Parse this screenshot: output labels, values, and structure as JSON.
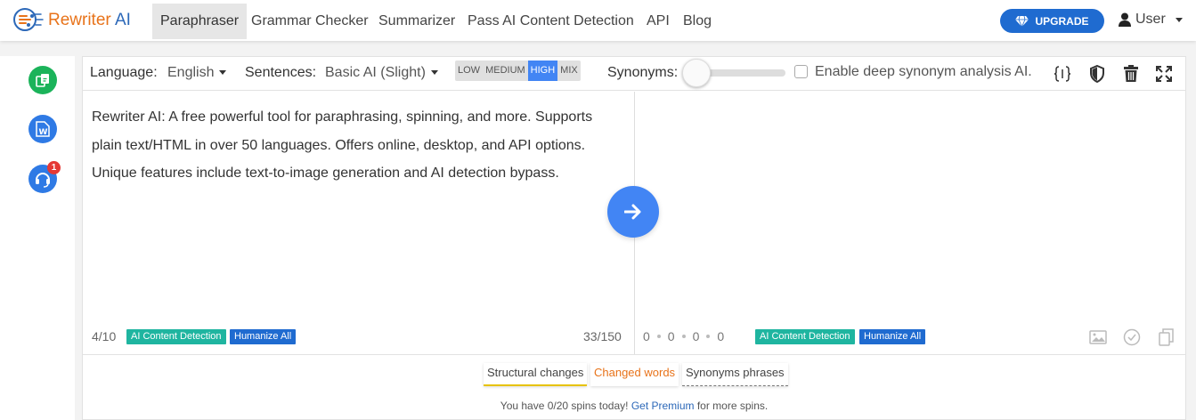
{
  "brand": {
    "name_main": "Rewriter",
    "name_ai": "AI"
  },
  "nav": {
    "items": [
      {
        "label": "Paraphraser",
        "active": true
      },
      {
        "label": "Grammar Checker",
        "active": false
      },
      {
        "label": "Summarizer",
        "active": false
      },
      {
        "label": "Pass AI Content Detection",
        "active": false
      },
      {
        "label": "API",
        "active": false
      },
      {
        "label": "Blog",
        "active": false
      }
    ],
    "upgrade_label": "UPGRADE",
    "user_label": "User"
  },
  "sidebar": {
    "items": [
      {
        "icon": "copy-document-icon",
        "color": "#1bb35a"
      },
      {
        "icon": "word-document-icon",
        "color": "#2f7ae5"
      },
      {
        "icon": "support-headset-icon",
        "color": "#2f7ae5",
        "badge": "1"
      }
    ]
  },
  "toolbar": {
    "language_label": "Language:",
    "language_value": "English",
    "sentences_label": "Sentences:",
    "sentences_value": "Basic AI (Slight)",
    "levels": [
      "LOW",
      "MEDIUM",
      "HIGH",
      "MIX"
    ],
    "active_level": "HIGH",
    "synonyms_label": "Synonyms:",
    "synonyms_level": 0,
    "deep_synonym_label": "Enable deep synonym analysis AI.",
    "deep_synonym_checked": false,
    "icons": [
      "braces-icon",
      "shield-icon",
      "trash-icon",
      "expand-icon"
    ]
  },
  "editor": {
    "input_text": "Rewriter AI: A free powerful tool for paraphrasing, spinning, and more. Supports plain text/HTML in over 50 languages. Offers online, desktop, and API options. Unique features include text-to-image generation and AI detection bypass.",
    "sentence_count": "4/10",
    "word_count": "33/150",
    "ai_detection_label": "AI Content Detection",
    "humanize_label": "Humanize All",
    "output_stats": [
      "0",
      "0",
      "0",
      "0"
    ],
    "output_icons": [
      "image-icon",
      "check-circle-icon",
      "copy-icon"
    ]
  },
  "legend": {
    "structural": "Structural changes",
    "changed": "Changed words",
    "synonyms": "Synonyms phrases"
  },
  "footer": {
    "spins_prefix": "You have 0/20 spins today!",
    "premium_link": "Get Premium",
    "spins_suffix": "for more spins."
  },
  "colors": {
    "accent_blue": "#4285f4",
    "brand_blue": "#1f6bd0",
    "brand_orange": "#e8731a",
    "teal_tag": "#1fb5a0",
    "highlight_yellow": "#e6c200"
  }
}
